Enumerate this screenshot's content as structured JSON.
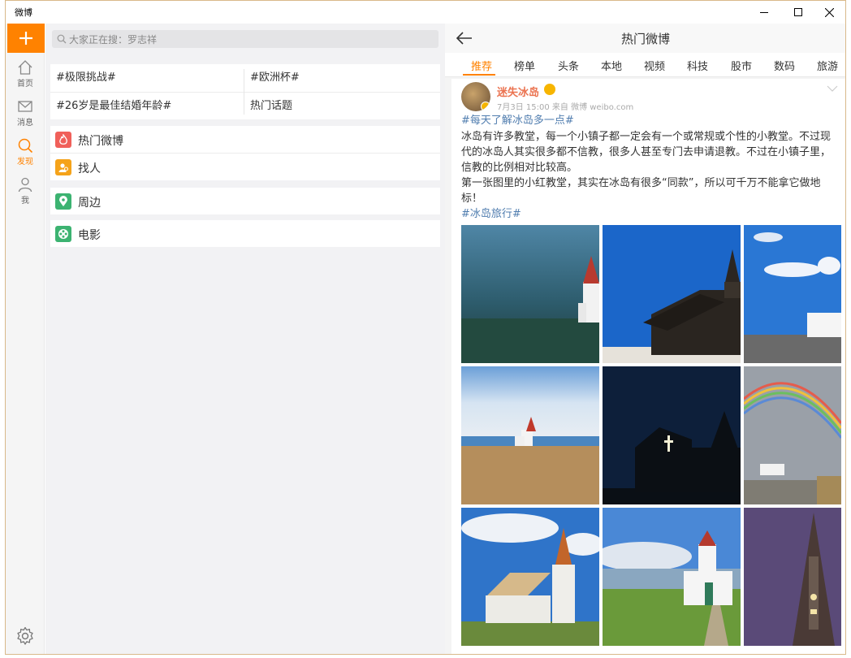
{
  "window": {
    "title": "微博"
  },
  "nav": {
    "items": [
      {
        "label": "首页",
        "icon": "home-icon"
      },
      {
        "label": "消息",
        "icon": "mail-icon"
      },
      {
        "label": "发现",
        "icon": "search-icon",
        "active": true
      },
      {
        "label": "我",
        "icon": "person-icon"
      }
    ],
    "accent": "#ff8200"
  },
  "search": {
    "placeholder": "大家正在搜：罗志祥"
  },
  "topics": [
    {
      "label": "#极限挑战#"
    },
    {
      "label": "#欧洲杯#"
    },
    {
      "label": "#26岁是最佳结婚年龄#"
    },
    {
      "label": "热门话题"
    }
  ],
  "menu": [
    {
      "label": "热门微博",
      "icon": "flame-icon",
      "color": "#f0605a"
    },
    {
      "label": "找人",
      "icon": "people-icon",
      "color": "#f5a31a"
    },
    {
      "label": "周边",
      "icon": "location-pin-icon",
      "color": "#3cb371"
    },
    {
      "label": "电影",
      "icon": "film-reel-icon",
      "color": "#3cb371"
    }
  ],
  "panel": {
    "title": "热门微博",
    "tabs": [
      "推荐",
      "榜单",
      "头条",
      "本地",
      "视频",
      "科技",
      "股市",
      "数码",
      "旅游"
    ]
  },
  "post": {
    "username": "迷失冰岛",
    "meta": "7月3日 15:00 来自 微博 weibo.com",
    "hashtag": "#每天了解冰岛多一点#",
    "lines": [
      "冰岛有许多教堂，每一个小镇子都一定会有一个或常规或个性的小教堂。不过现",
      "代的冰岛人其实很多都不信教，很多人甚至专门去申请退教。不过在小镇子里，",
      "信教的比例相对比较高。",
      "第一张图里的小红教堂，其实在冰岛有很多“同款”，所以可千万不能拿它做地",
      "标！"
    ],
    "tag2": "#冰岛旅行#"
  }
}
